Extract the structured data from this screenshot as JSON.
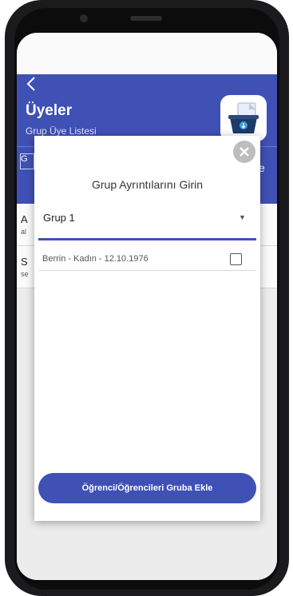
{
  "app": {
    "title": "Üyeler",
    "subtitle": "Grup Üye Listesi",
    "back_icon": "chevron-left-icon",
    "app_icon": "shopping-basket-file-icon",
    "tab_left_label": "G",
    "tab_right_label": "e"
  },
  "list": {
    "items": [
      {
        "title": "A",
        "detail": "al"
      },
      {
        "title": "S",
        "detail": "se"
      }
    ]
  },
  "modal": {
    "title": "Grup Ayrıntılarını Girin",
    "close_icon": "close-circle-icon",
    "group_select": {
      "selected": "Grup 1",
      "caret_icon": "dropdown-caret-icon"
    },
    "members": [
      {
        "label": "Berrin - Kadın - 12.10.1976",
        "checked": false
      }
    ],
    "add_button": "Öğrenci/Öğrencileri Gruba Ekle"
  },
  "colors": {
    "primary": "#3f51b5",
    "background": "#ebebeb",
    "modal_bg": "#ffffff",
    "close_bg": "#bdbdbd"
  }
}
